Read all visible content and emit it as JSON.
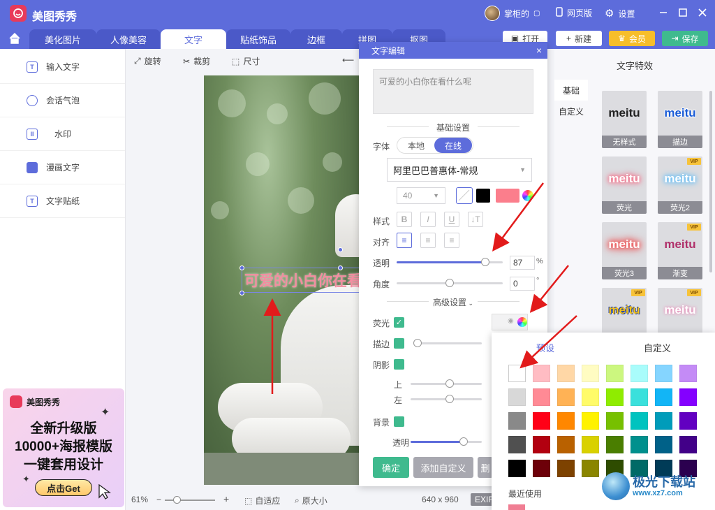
{
  "app": {
    "name": "美图秀秀",
    "user": "掌柜的",
    "web_version": "网页版",
    "settings": "设置"
  },
  "tabs": [
    "美化图片",
    "人像美容",
    "文字",
    "贴纸饰品",
    "边框",
    "拼图",
    "抠图"
  ],
  "active_tab": "文字",
  "top_buttons": {
    "open": "打开",
    "new": "新建",
    "vip": "会员",
    "save": "保存"
  },
  "left_menu": [
    "输入文字",
    "会话气泡",
    "水印",
    "漫画文字",
    "文字贴纸"
  ],
  "ad": {
    "logo": "美图秀秀",
    "line1": "全新升级版",
    "line2": "10000+海报模版",
    "line3": "一键套用设计",
    "button": "点击Get"
  },
  "toolbar": {
    "rotate": "旋转",
    "crop": "裁剪",
    "size": "尺寸"
  },
  "canvas": {
    "overlay_text": "可爱的小白你在看什么呢"
  },
  "status": {
    "zoom": "61%",
    "fit": "自适应",
    "original": "原大小",
    "dimensions": "640 x 960",
    "exif": "EXIF"
  },
  "dialog": {
    "title": "文字编辑",
    "close": "×",
    "text": "可爱的小白你在看什么呢",
    "basic_settings": "基础设置",
    "font_label": "字体",
    "font_local": "本地",
    "font_online": "在线",
    "font_name": "阿里巴巴普惠体-常规",
    "font_size": "40",
    "style_label": "样式",
    "align_label": "对齐",
    "opacity_label": "透明",
    "opacity_value": "87",
    "opacity_unit": "%",
    "angle_label": "角度",
    "angle_value": "0",
    "angle_unit": "°",
    "advanced_settings": "高级设置",
    "glow_label": "荧光",
    "stroke_label": "描边",
    "shadow_label": "阴影",
    "shadow_up": "上",
    "shadow_left": "左",
    "background_label": "背景",
    "bg_opacity_label": "透明",
    "confirm": "确定",
    "add_custom": "添加自定义",
    "third_button": "删"
  },
  "right_panel": {
    "title": "文字特效",
    "tabs": [
      "基础",
      "自定义"
    ],
    "effects": [
      {
        "sample": "meitu",
        "name": "无样式",
        "vip": false
      },
      {
        "sample": "meitu",
        "name": "描边",
        "vip": false
      },
      {
        "sample": "meitu",
        "name": "荧光",
        "vip": false
      },
      {
        "sample": "meitu",
        "name": "荧光2",
        "vip": true
      },
      {
        "sample": "meitu",
        "name": "荧光3",
        "vip": false
      },
      {
        "sample": "meitu",
        "name": "渐变",
        "vip": true
      },
      {
        "sample": "meitu",
        "name": "",
        "vip": true
      },
      {
        "sample": "meitu",
        "name": "",
        "vip": true
      }
    ],
    "vip_badge": "VIP"
  },
  "color_picker": {
    "tab_preset": "预设",
    "tab_custom": "自定义",
    "recent": "最近使用",
    "swatches": [
      [
        "#ffffff",
        "#ffbcc3",
        "#ffd7a6",
        "#fffcc2",
        "#ccf77f",
        "#a9fcfb",
        "#85d5ff",
        "#c48bf6"
      ],
      [
        "#d8d8d8",
        "#ff8a95",
        "#ffb255",
        "#fffb69",
        "#8fec00",
        "#3ae0dc",
        "#12b5f6",
        "#8400ff"
      ],
      [
        "#898989",
        "#ff0017",
        "#ff8700",
        "#fff200",
        "#77c000",
        "#00c3bf",
        "#009cba",
        "#6200c1"
      ],
      [
        "#505050",
        "#b20010",
        "#b96100",
        "#d9d100",
        "#4a7e00",
        "#00908d",
        "#006188",
        "#420088"
      ],
      [
        "#000000",
        "#6d0009",
        "#7d4200",
        "#8a8500",
        "#2e4c00",
        "#006a67",
        "#003b57",
        "#2b004f"
      ]
    ],
    "recent_colors": [
      "#f07e93"
    ]
  },
  "watermark": {
    "text": "极光下载站",
    "url": "www.xz7.com"
  },
  "colors": {
    "primary": "#5d6cdb",
    "green": "#3fba8e",
    "text_pink": "#f28ea0",
    "arrow": "#e21b1b"
  }
}
